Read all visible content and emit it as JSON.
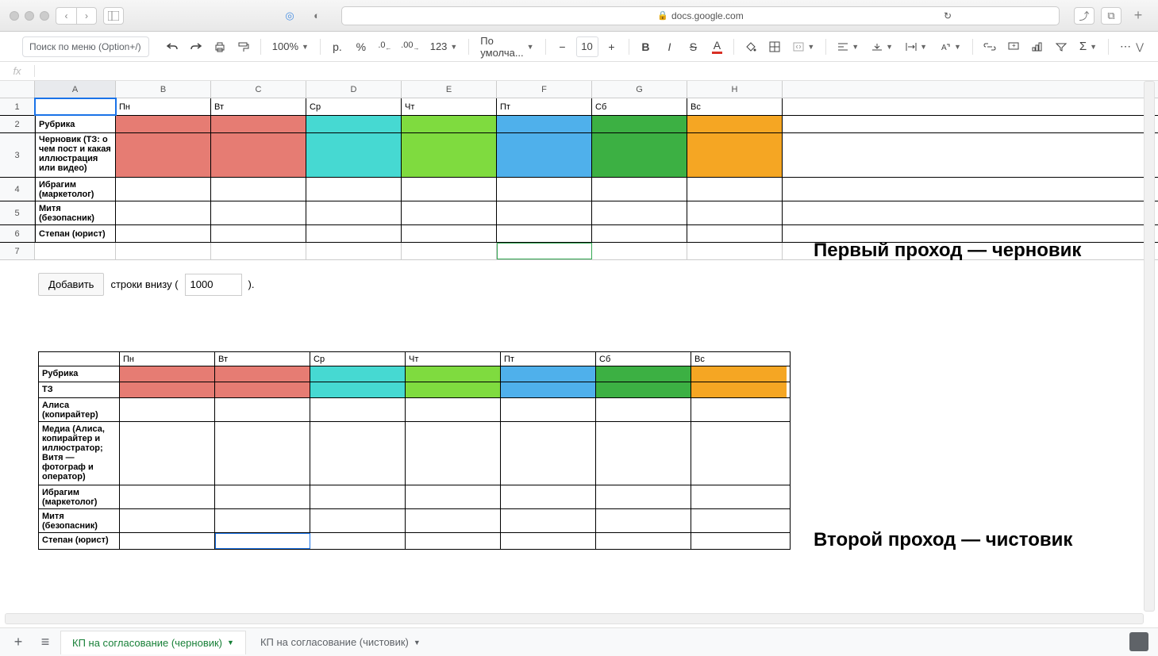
{
  "browser": {
    "url": "docs.google.com"
  },
  "toolbar": {
    "menu_search_placeholder": "Поиск по меню (Option+/)",
    "zoom": "100%",
    "currency": "р.",
    "percent": "%",
    "dec_less": ".0",
    "dec_more": ".00",
    "num_fmt": "123",
    "font": "По умолча...",
    "font_size": "10"
  },
  "columns": [
    "A",
    "B",
    "C",
    "D",
    "E",
    "F",
    "G",
    "H"
  ],
  "rows": [
    "1",
    "2",
    "3",
    "4",
    "5",
    "6",
    "7"
  ],
  "days": [
    "Пн",
    "Вт",
    "Ср",
    "Чт",
    "Пт",
    "Сб",
    "Вс"
  ],
  "table1": {
    "r2": "Рубрика",
    "r3": "Черновик (ТЗ: о чем пост и какая иллюстрация или видео)",
    "r4": "Ибрагим (маркетолог)",
    "r5": "Митя (безопасник)",
    "r6": "Степан (юрист)"
  },
  "add_rows": {
    "button": "Добавить",
    "label_before": "строки внизу (",
    "value": "1000",
    "label_after": ")."
  },
  "table2": {
    "r1": "Рубрика",
    "r2": "ТЗ",
    "r3": "Алиса (копирайтер)",
    "r4": "Медиа (Алиса, копирайтер и иллюстратор; Витя — фотограф и оператор)",
    "r5": "Ибрагим (маркетолог)",
    "r6": "Митя (безопасник)",
    "r7": "Степан (юрист)"
  },
  "annotations": {
    "a1": "Первый проход — черновик",
    "a2": "Второй проход — чистовик"
  },
  "tabs": {
    "t1": "КП на согласование (черновик)",
    "t2": "КП на согласование (чистовик)"
  },
  "colors": {
    "red": "#e67c73",
    "cyan": "#46d9d2",
    "lime": "#7fdb3f",
    "blue": "#4fb0eb",
    "green": "#3cb043",
    "orange": "#f5a623"
  }
}
